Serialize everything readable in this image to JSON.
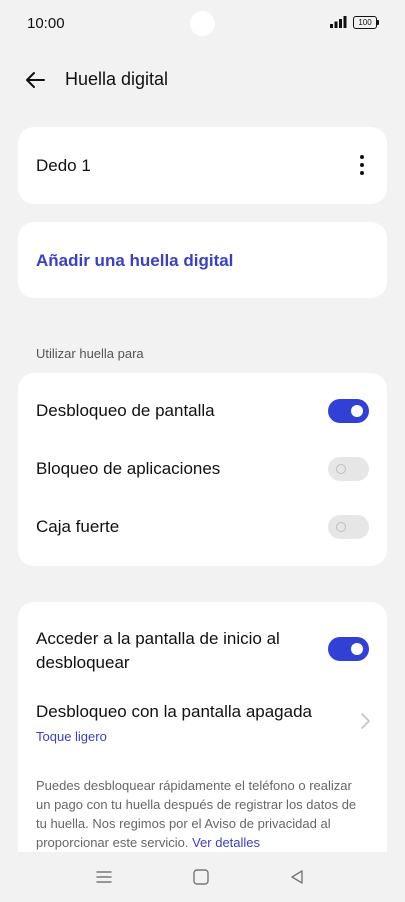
{
  "status": {
    "time": "10:00",
    "battery": "100"
  },
  "header": {
    "title": "Huella digital"
  },
  "finger_card": {
    "label": "Dedo 1"
  },
  "add_card": {
    "label": "Añadir una huella digital"
  },
  "section": {
    "label": "Utilizar huella para"
  },
  "use_for": [
    {
      "label": "Desbloqueo de pantalla",
      "on": true
    },
    {
      "label": "Bloqueo de aplicaciones",
      "on": false
    },
    {
      "label": "Caja fuerte",
      "on": false
    }
  ],
  "options": {
    "home_label": "Acceder a la pantalla de inicio al desbloquear",
    "home_on": true,
    "screen_off_label": "Desbloqueo con la pantalla apagada",
    "screen_off_value": "Toque ligero",
    "description": "Puedes desbloquear rápidamente el teléfono o realizar un pago con tu huella después de registrar los datos de tu huella. Nos regimos por el Aviso de privacidad al proporcionar este servicio.",
    "details_link": "Ver detalles"
  },
  "colors": {
    "accent": "#3240d6",
    "link": "#3a3fc9",
    "background": "#f2f2f2"
  },
  "icons": [
    "back-arrow-icon",
    "more-vert-icon",
    "chevron-right-icon",
    "menu-icon",
    "home-square-icon",
    "back-triangle-icon",
    "signal-icon",
    "battery-icon"
  ]
}
